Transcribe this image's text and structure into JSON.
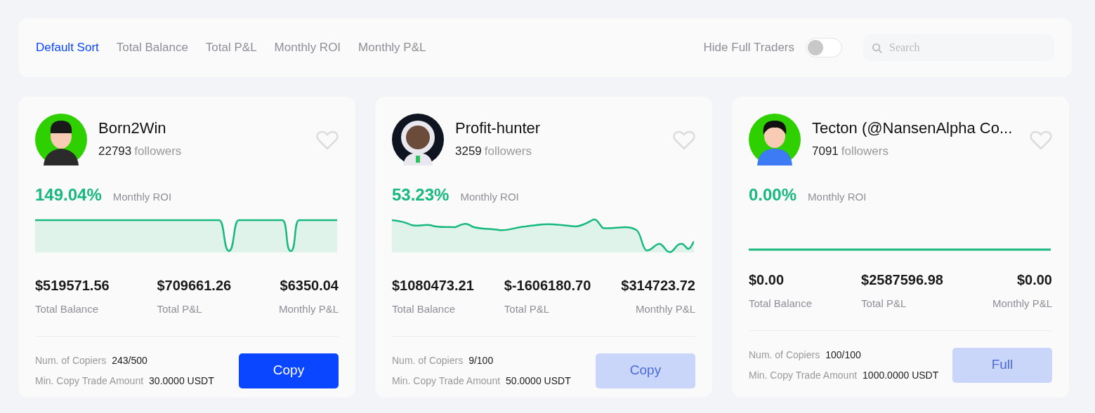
{
  "sort_tabs": [
    {
      "label": "Default Sort",
      "selected": true
    },
    {
      "label": "Total Balance",
      "selected": false
    },
    {
      "label": "Total P&L",
      "selected": false
    },
    {
      "label": "Monthly ROI",
      "selected": false
    },
    {
      "label": "Monthly P&L",
      "selected": false
    }
  ],
  "hide_full_traders": {
    "label": "Hide Full Traders",
    "on": false
  },
  "search": {
    "placeholder": "Search"
  },
  "traders": [
    {
      "name": "Born2Win",
      "followers_count": "22793",
      "followers_label": "followers",
      "favorited": false,
      "roi": "149.04%",
      "roi_label": "Monthly ROI",
      "stats": [
        {
          "value": "$519571.56",
          "label": "Total Balance"
        },
        {
          "value": "$709661.26",
          "label": "Total P&L"
        },
        {
          "value": "$6350.04",
          "label": "Monthly P&L"
        }
      ],
      "copiers_label": "Num. of Copiers",
      "copiers": "243/500",
      "min_label": "Min. Copy Trade Amount",
      "min_amount": "30.0000 USDT",
      "button": {
        "label": "Copy",
        "disabled": false
      }
    },
    {
      "name": "Profit-hunter",
      "followers_count": "3259",
      "followers_label": "followers",
      "favorited": false,
      "roi": "53.23%",
      "roi_label": "Monthly ROI",
      "stats": [
        {
          "value": "$1080473.21",
          "label": "Total Balance"
        },
        {
          "value": "$-1606180.70",
          "label": "Total P&L"
        },
        {
          "value": "$314723.72",
          "label": "Monthly P&L"
        }
      ],
      "copiers_label": "Num. of Copiers",
      "copiers": "9/100",
      "min_label": "Min. Copy Trade Amount",
      "min_amount": "50.0000 USDT",
      "button": {
        "label": "Copy",
        "disabled": true
      }
    },
    {
      "name": "Tecton (@NansenAlpha Co...",
      "followers_count": "7091",
      "followers_label": "followers",
      "favorited": false,
      "roi": "0.00%",
      "roi_label": "Monthly ROI",
      "stats": [
        {
          "value": "$0.00",
          "label": "Total Balance"
        },
        {
          "value": "$2587596.98",
          "label": "Total P&L"
        },
        {
          "value": "$0.00",
          "label": "Monthly P&L"
        }
      ],
      "copiers_label": "Num. of Copiers",
      "copiers": "100/100",
      "min_label": "Min. Copy Trade Amount",
      "min_amount": "1000.0000 USDT",
      "button": {
        "label": "Full",
        "disabled": true
      }
    }
  ]
}
